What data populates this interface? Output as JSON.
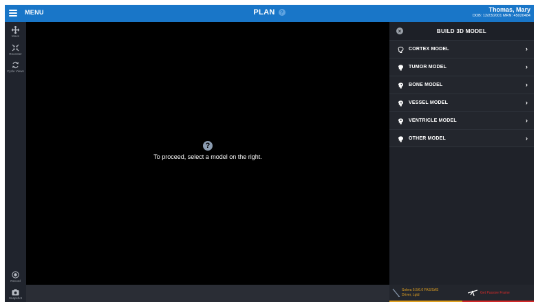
{
  "header": {
    "menu_label": "MENU",
    "title": "PLAN",
    "help_glyph": "?",
    "patient_name": "Thomas, Mary",
    "patient_meta": "DOB: 12/23/2001  MRN: 45020484"
  },
  "toolbar": {
    "move": "Move",
    "recenter": "Recenter",
    "cycle_views": "Cycle Views",
    "record": "Record",
    "snapshot": "Snapshot"
  },
  "viewport": {
    "prompt_glyph": "?",
    "prompt_text": "To proceed, select a model on the right."
  },
  "panel": {
    "close_glyph": "×",
    "title": "BUILD 3D MODEL",
    "items": [
      {
        "label": "CORTEX MODEL",
        "icon": "brain-outline-icon"
      },
      {
        "label": "TUMOR MODEL",
        "icon": "head-icon"
      },
      {
        "label": "BONE MODEL",
        "icon": "skull-icon"
      },
      {
        "label": "VESSEL MODEL",
        "icon": "head-vessel-icon"
      },
      {
        "label": "VENTRICLE MODEL",
        "icon": "head-ventricle-icon"
      },
      {
        "label": "OTHER MODEL",
        "icon": "head-icon"
      }
    ],
    "chevron": "›"
  },
  "status": {
    "probe_line1": "Solera 5.5/6.0 FAS/SAS",
    "probe_line2": "Driver, Lgtd",
    "frame_text": "Get Passive Frame",
    "probe_color": "#e0a020",
    "frame_color": "#d42a2a"
  },
  "colors": {
    "header_bg": "#1976c8",
    "panel_bg": "#1f2229",
    "viewport_bg": "#000000"
  }
}
